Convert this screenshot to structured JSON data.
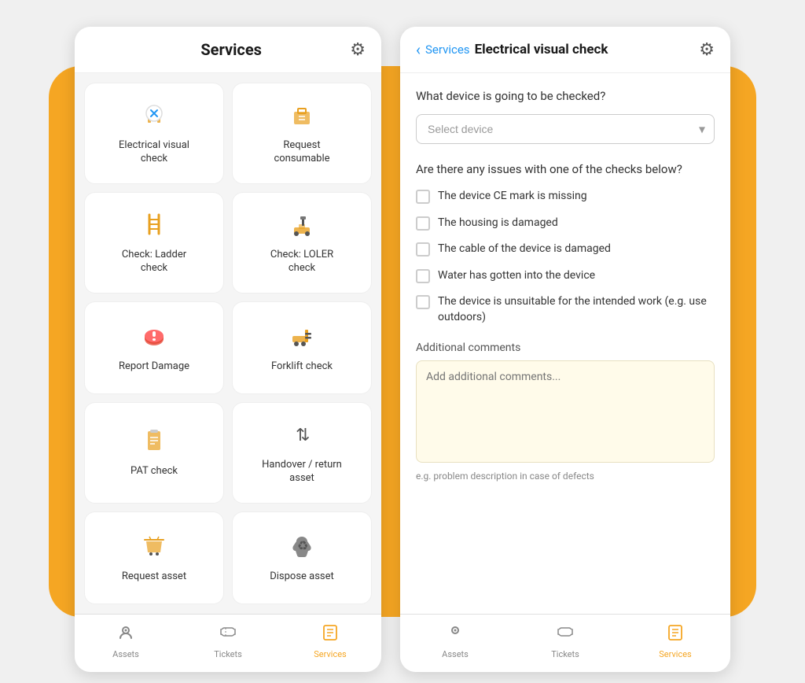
{
  "orange_bg": true,
  "left_screen": {
    "header": {
      "title": "Services",
      "gear_icon": "⚙"
    },
    "service_cards": [
      {
        "id": "electrical-visual-check",
        "icon": "🔌",
        "label": "Electrical visual\ncheck"
      },
      {
        "id": "request-consumable",
        "icon": "📦",
        "label": "Request\nconsumable"
      },
      {
        "id": "check-ladder",
        "icon": "🪜",
        "label": "Check: Ladder\ncheck"
      },
      {
        "id": "check-loler",
        "icon": "🏗",
        "label": "Check: LOLER\ncheck"
      },
      {
        "id": "report-damage",
        "icon": "🚨",
        "label": "Report Damage"
      },
      {
        "id": "forklift-check",
        "icon": "🚜",
        "label": "Forklift check"
      },
      {
        "id": "pat-check",
        "icon": "📋",
        "label": "PAT check"
      },
      {
        "id": "handover-return",
        "icon": "↕",
        "label": "Handover / return\nasset"
      },
      {
        "id": "request-asset",
        "icon": "🛒",
        "label": "Request asset"
      },
      {
        "id": "dispose-asset",
        "icon": "♻",
        "label": "Dispose asset"
      }
    ],
    "bottom_nav": [
      {
        "id": "assets",
        "icon": "📍",
        "label": "Assets",
        "active": false
      },
      {
        "id": "tickets",
        "icon": "🎟",
        "label": "Tickets",
        "active": false
      },
      {
        "id": "services",
        "icon": "📋",
        "label": "Services",
        "active": true
      }
    ]
  },
  "right_screen": {
    "header": {
      "back_icon": "‹",
      "breadcrumb": "Services",
      "page_title": "Electrical visual check",
      "gear_icon": "⚙"
    },
    "device_section": {
      "question": "What device is going to be checked?",
      "select_placeholder": "Select device"
    },
    "checks_section": {
      "question": "Are there any issues with one of the checks below?",
      "items": [
        {
          "id": "ce-mark",
          "label": "The device CE mark is missing"
        },
        {
          "id": "housing",
          "label": "The housing is damaged"
        },
        {
          "id": "cable",
          "label": "The cable of the device is damaged"
        },
        {
          "id": "water",
          "label": "Water has gotten into the device"
        },
        {
          "id": "unsuitable",
          "label": "The device is unsuitable for the intended work (e.g. use outdoors)"
        }
      ]
    },
    "comments_section": {
      "label": "Additional comments",
      "placeholder": "Add additional comments...",
      "helper": "e.g. problem description in case of defects"
    },
    "bottom_nav": [
      {
        "id": "assets",
        "icon": "📍",
        "label": "Assets",
        "active": false
      },
      {
        "id": "tickets",
        "icon": "🎟",
        "label": "Tickets",
        "active": false
      },
      {
        "id": "services",
        "icon": "📋",
        "label": "Services",
        "active": true
      }
    ]
  }
}
